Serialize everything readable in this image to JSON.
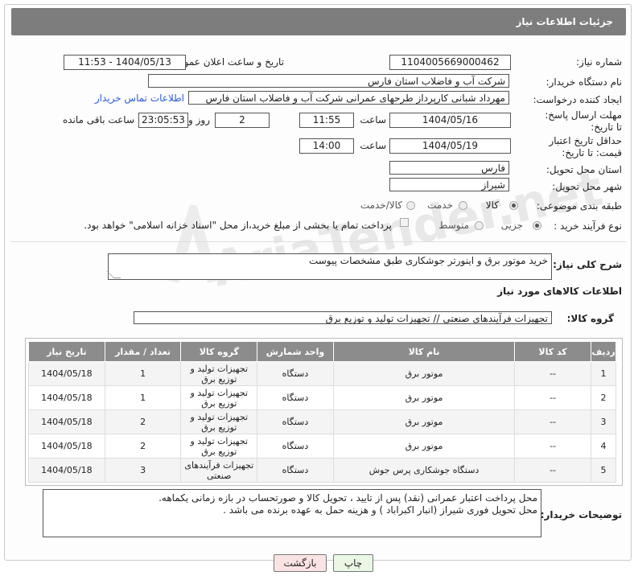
{
  "header": {
    "title": "جزئیات اطلاعات نیاز"
  },
  "fields": {
    "need_number_label": "شماره نیاز:",
    "need_number": "1104005669000462",
    "announce_label": "تاریخ و ساعت اعلان عمومی:",
    "announce_value": "1404/05/13 - 11:53",
    "buyer_label": "نام دستگاه خریدار:",
    "buyer_value": "شرکت آب و فاضلاب استان فارس",
    "creator_label": "ایجاد کننده درخواست:",
    "creator_value": "مهرداد شبانی کارپرداز طرحهای عمرانی  شرکت آب و فاضلاب استان فارس",
    "contact_link": "اطلاعات تماس خریدار",
    "deadline_label": "مهلت ارسال پاسخ: تا تاریخ:",
    "deadline_date": "1404/05/16",
    "time_label": "ساعت",
    "deadline_time": "11:55",
    "days_value": "2",
    "days_label": "روز و",
    "remaining_time": "23:05:53",
    "remaining_label": "ساعت باقی مانده",
    "price_label": "حداقل تاریخ اعتبار قیمت: تا تاریخ:",
    "price_date": "1404/05/19",
    "price_time": "14:00",
    "province_label": "استان محل تحویل:",
    "province_value": "فارس",
    "city_label": "شهر محل تحویل:",
    "city_value": "شیراز",
    "category_label": "طبقه بندی موضوعی:",
    "category_options": [
      "کالا",
      "خدمت",
      "کالا/خدمت"
    ],
    "process_label": "نوع فرآیند خرید :",
    "process_options": [
      "جزیی",
      "متوسط"
    ],
    "process_note": "پرداخت تمام یا بخشی از مبلغ خرید،از محل \"اسناد خزانه اسلامی\" خواهد بود."
  },
  "summary": {
    "label": "شرح کلی نیاز:",
    "value": "خرید موتور برق و اینورتر جوشکاری طبق مشخصات پیوست"
  },
  "goods": {
    "section_title": "اطلاعات کالاهای مورد نیاز",
    "group_label": "گروه کالا:",
    "group_value": "تجهیزات فرآیندهای صنعتی // تجهیزات تولید و توزیع برق",
    "columns": [
      "ردیف",
      "کد کالا",
      "نام کالا",
      "واحد شمارش",
      "گروه کالا",
      "تعداد / مقدار",
      "تاریخ نیاز"
    ],
    "rows": [
      {
        "idx": "1",
        "code": "--",
        "name": "موتور برق",
        "unit": "دستگاه",
        "group": "تجهیزات تولید و توزیع برق",
        "qty": "1",
        "date": "1404/05/18"
      },
      {
        "idx": "2",
        "code": "--",
        "name": "موتور برق",
        "unit": "دستگاه",
        "group": "تجهیزات تولید و توزیع برق",
        "qty": "1",
        "date": "1404/05/18"
      },
      {
        "idx": "3",
        "code": "--",
        "name": "موتور برق",
        "unit": "دستگاه",
        "group": "تجهیزات تولید و توزیع برق",
        "qty": "2",
        "date": "1404/05/18"
      },
      {
        "idx": "4",
        "code": "--",
        "name": "موتور برق",
        "unit": "دستگاه",
        "group": "تجهیزات تولید و توزیع برق",
        "qty": "2",
        "date": "1404/05/18"
      },
      {
        "idx": "5",
        "code": "--",
        "name": "دستگاه جوشکاری پرس جوش",
        "unit": "دستگاه",
        "group": "تجهیزات فرآیندهای صنعتی",
        "qty": "3",
        "date": "1404/05/18"
      }
    ]
  },
  "notes": {
    "label": "توضیحات خریدار:",
    "line1": "محل پرداخت اعتبار عمرانی (نقد) پس از تایید ، تحویل کالا و صورتحساب در بازه زمانی یکماهه.",
    "line2": "محل تحویل فوری شیراز (انبار اکبراباد ) و هزینه حمل به عهده برنده می باشد ."
  },
  "buttons": {
    "print": "چاپ",
    "back": "بازگشت"
  },
  "watermark": "AriaTender.net"
}
